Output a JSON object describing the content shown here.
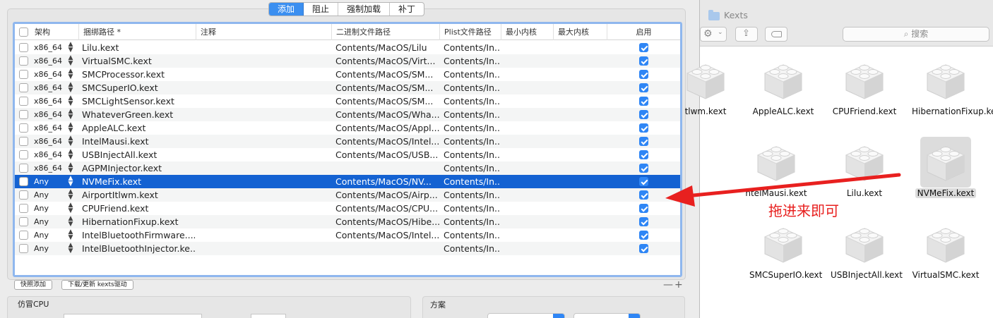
{
  "tabs": [
    {
      "label": "添加",
      "active": true
    },
    {
      "label": "阻止",
      "active": false
    },
    {
      "label": "强制加载",
      "active": false
    },
    {
      "label": "补丁",
      "active": false
    }
  ],
  "table": {
    "headers": [
      "架构",
      "捆绑路径 *",
      "注释",
      "二进制文件路径",
      "Plist文件路径",
      "最小内核",
      "最大内核",
      "启用"
    ],
    "rows": [
      {
        "arch": "x86_64",
        "bundle": "Lilu.kext",
        "binary": "Contents/MacOS/Lilu",
        "plist": "Contents/In...",
        "enabled": true
      },
      {
        "arch": "x86_64",
        "bundle": "VirtualSMC.kext",
        "binary": "Contents/MacOS/Virt...",
        "plist": "Contents/In...",
        "enabled": true
      },
      {
        "arch": "x86_64",
        "bundle": "SMCProcessor.kext",
        "binary": "Contents/MacOS/SM...",
        "plist": "Contents/In...",
        "enabled": true
      },
      {
        "arch": "x86_64",
        "bundle": "SMCSuperIO.kext",
        "binary": "Contents/MacOS/SM...",
        "plist": "Contents/In...",
        "enabled": true
      },
      {
        "arch": "x86_64",
        "bundle": "SMCLightSensor.kext",
        "binary": "Contents/MacOS/SM...",
        "plist": "Contents/In...",
        "enabled": true
      },
      {
        "arch": "x86_64",
        "bundle": "WhateverGreen.kext",
        "binary": "Contents/MacOS/Wha...",
        "plist": "Contents/In...",
        "enabled": true
      },
      {
        "arch": "x86_64",
        "bundle": "AppleALC.kext",
        "binary": "Contents/MacOS/Appl...",
        "plist": "Contents/In...",
        "enabled": true
      },
      {
        "arch": "x86_64",
        "bundle": "IntelMausi.kext",
        "binary": "Contents/MacOS/Intel...",
        "plist": "Contents/In...",
        "enabled": true
      },
      {
        "arch": "x86_64",
        "bundle": "USBInjectAll.kext",
        "binary": "Contents/MacOS/USB...",
        "plist": "Contents/In...",
        "enabled": true
      },
      {
        "arch": "x86_64",
        "bundle": "AGPMInjector.kext",
        "binary": "",
        "plist": "Contents/In...",
        "enabled": true
      },
      {
        "arch": "Any",
        "bundle": "NVMeFix.kext",
        "binary": "Contents/MacOS/NV...",
        "plist": "Contents/In...",
        "enabled": true,
        "selected": true
      },
      {
        "arch": "Any",
        "bundle": "AirportItlwm.kext",
        "binary": "Contents/MacOS/Airp...",
        "plist": "Contents/In...",
        "enabled": true
      },
      {
        "arch": "Any",
        "bundle": "CPUFriend.kext",
        "binary": "Contents/MacOS/CPU...",
        "plist": "Contents/In...",
        "enabled": true
      },
      {
        "arch": "Any",
        "bundle": "HibernationFixup.kext",
        "binary": "Contents/MacOS/Hibe...",
        "plist": "Contents/In...",
        "enabled": true
      },
      {
        "arch": "Any",
        "bundle": "IntelBluetoothFirmware....",
        "binary": "Contents/MacOS/Intel...",
        "plist": "Contents/In...",
        "enabled": true
      },
      {
        "arch": "Any",
        "bundle": "IntelBluetoothInjector.ke...",
        "binary": "",
        "plist": "Contents/In...",
        "enabled": true
      }
    ]
  },
  "buttons": {
    "quick_add": "快照添加",
    "download": "下载/更新 kexts驱动",
    "plus_minus": "—+"
  },
  "sections": {
    "fake_cpu": "仿冒CPU",
    "scheme": "方案"
  },
  "finder": {
    "title": "Kexts",
    "search_placeholder": "搜索",
    "items": [
      {
        "name": "tlwm.kext"
      },
      {
        "name": "AppleALC.kext"
      },
      {
        "name": "CPUFriend.kext"
      },
      {
        "name": "HibernationFixup.kext"
      },
      {
        "name": "ntelMausi.kext"
      },
      {
        "name": "Lilu.kext"
      },
      {
        "name": "NVMeFix.kext",
        "selected": true
      },
      {
        "name": "SMCSuperIO.kext"
      },
      {
        "name": "USBInjectAll.kext"
      },
      {
        "name": "VirtualSMC.kext"
      }
    ]
  },
  "annotation": {
    "text": "拖进来即可",
    "color": "#e8201f"
  },
  "colors": {
    "accent": "#2f86f5",
    "selection": "#1462d2"
  }
}
